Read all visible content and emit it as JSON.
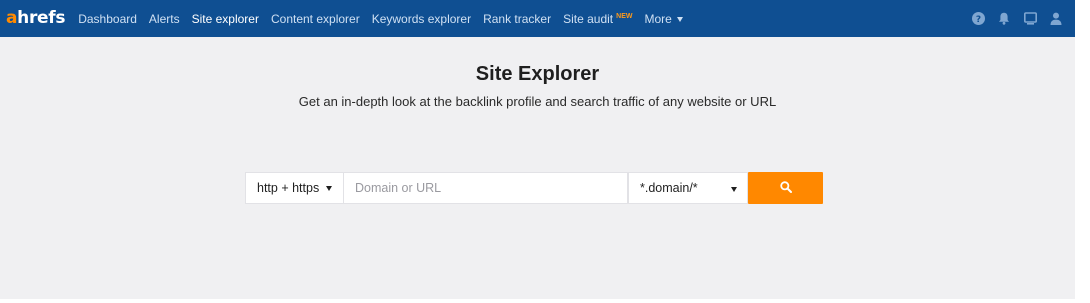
{
  "brand": {
    "logo_first": "a",
    "logo_rest": "hrefs"
  },
  "nav": {
    "items": [
      {
        "label": "Dashboard",
        "active": false
      },
      {
        "label": "Alerts",
        "active": false
      },
      {
        "label": "Site explorer",
        "active": true
      },
      {
        "label": "Content explorer",
        "active": false
      },
      {
        "label": "Keywords explorer",
        "active": false
      },
      {
        "label": "Rank tracker",
        "active": false
      },
      {
        "label": "Site audit",
        "active": false,
        "badge": "NEW"
      },
      {
        "label": "More",
        "active": false
      }
    ],
    "icons": [
      "help-icon",
      "bell-icon",
      "monitor-icon",
      "user-icon"
    ]
  },
  "page": {
    "title": "Site Explorer",
    "subtitle": "Get an in-depth look at the backlink profile and search traffic of any website or URL"
  },
  "search": {
    "protocol": "http + https",
    "placeholder": "Domain or URL",
    "value": "",
    "mode": "*.domain/*",
    "button_icon": "search-icon"
  },
  "colors": {
    "navbar": "#0f4f92",
    "accent": "#ff8800",
    "background": "#f0f0f2",
    "badge": "#ff9a1a"
  }
}
